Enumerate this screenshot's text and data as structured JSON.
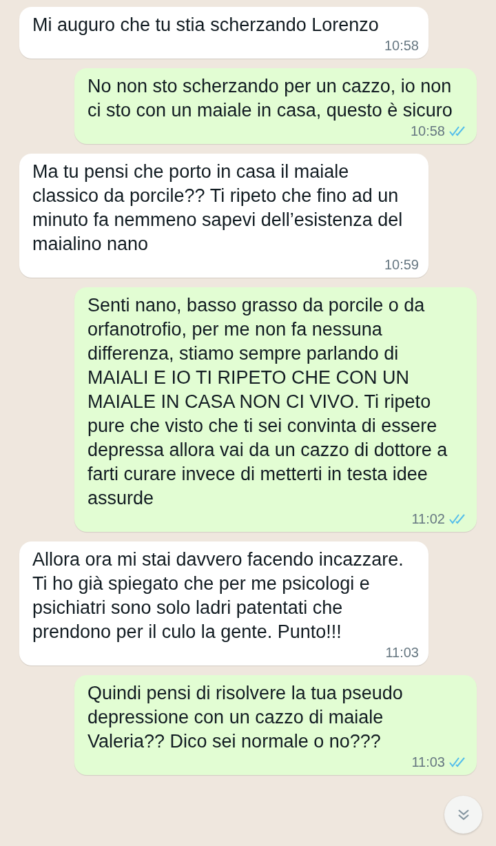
{
  "messages": [
    {
      "kind": "incoming",
      "text": "Mi auguro che tu stia scherzando Lorenzo",
      "time": "10:58"
    },
    {
      "kind": "outgoing",
      "text": "No non sto scherzando per un cazzo, io non ci sto con un maiale in casa, questo è sicuro",
      "time": "10:58",
      "read": true
    },
    {
      "kind": "incoming",
      "text": "Ma tu pensi che porto in casa il maiale classico da porcile?? Ti ripeto che fino ad un minuto fa nemmeno sapevi dell’esistenza del maialino nano",
      "time": "10:59"
    },
    {
      "kind": "outgoing",
      "text": "Senti nano, basso grasso da porcile o da orfanotrofio, per me non fa nessuna differenza, stiamo sempre parlando di MAIALI E IO TI RIPETO CHE CON UN MAIALE IN CASA NON CI VIVO. Ti ripeto pure che visto che ti sei convinta di essere depressa allora vai da un cazzo di dottore a farti curare invece di metterti in testa idee assurde",
      "time": "11:02",
      "read": true
    },
    {
      "kind": "incoming",
      "text": "Allora ora mi stai davvero facendo incazzare. Ti ho già spiegato che per me psicologi e psichiatri sono solo ladri patentati che prendono per il culo la gente. Punto!!!",
      "time": "11:03"
    },
    {
      "kind": "outgoing",
      "text": "Quindi pensi di risolvere la tua pseudo depressione con un cazzo di maiale Valeria?? Dico sei normale o no???",
      "time": "11:03",
      "read": true
    }
  ]
}
